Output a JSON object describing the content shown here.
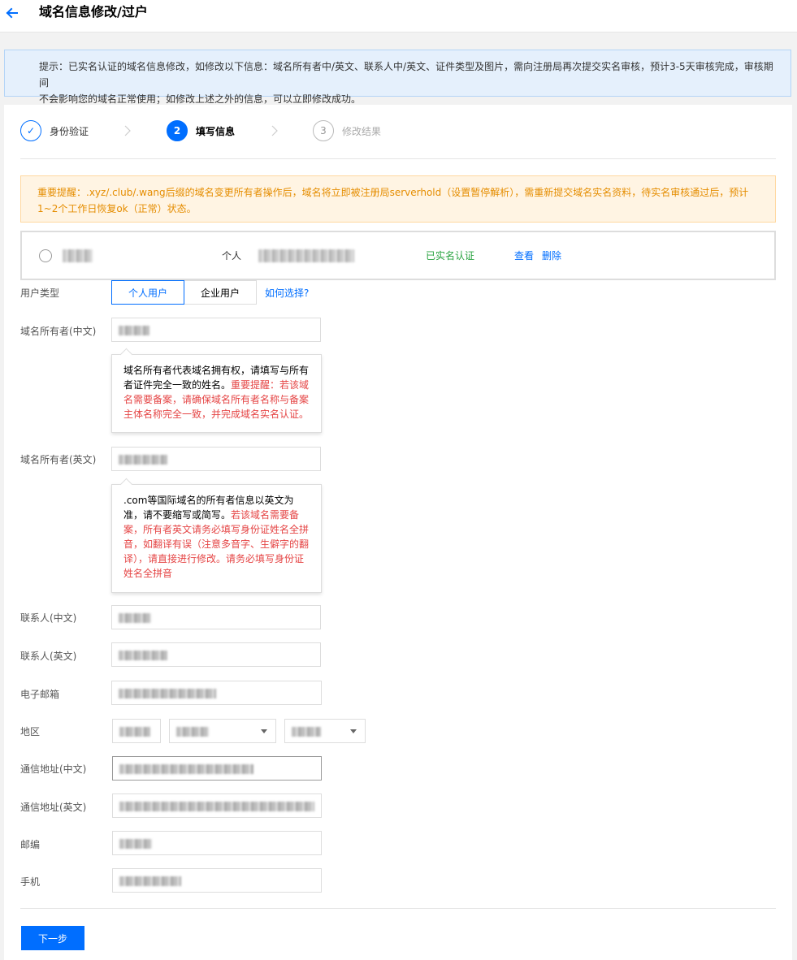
{
  "header": {
    "title": "域名信息修改/过户",
    "back_icon": "arrow-left-icon"
  },
  "notice": {
    "lines": [
      "提示：已实名认证的域名信息修改，如修改以下信息：域名所有者中/英文、联系人中/英文、证件类型及图片，需向注册局再次提交实名审核，预计3-5天审核完成，审核期间",
      "不会影响您的域名正常使用；如修改上述之外的信息，可以立即修改成功。"
    ]
  },
  "stepper": {
    "steps": [
      {
        "mark": "✓",
        "label": "身份验证",
        "state": "done"
      },
      {
        "mark": "2",
        "label": "填写信息",
        "state": "active"
      },
      {
        "mark": "3",
        "label": "修改结果",
        "state": "pending"
      }
    ]
  },
  "warning": {
    "lines": [
      "重要提醒：.xyz/.club/.wang后缀的域名变更所有者操作后，域名将立即被注册局serverhold（设置暂停解析），需重新提交域名实名资料，待实名审核通过后，预计",
      "1~2个工作日恢复ok（正常）状态。"
    ]
  },
  "contact_card": {
    "type": "个人",
    "status": "已实名认证",
    "view_label": "查看",
    "delete_label": "删除"
  },
  "form": {
    "user_type_label": "用户类型",
    "user_type_options": [
      "个人用户",
      "企业用户"
    ],
    "user_type_selected": "个人用户",
    "help_link": "如何选择?",
    "owner_cn_label": "域名所有者(中文)",
    "owner_cn_tip": {
      "plain": "域名所有者代表域名拥有权，请填写与所有者证件完全一致的姓名。",
      "warning": "重要提醒：若该域名需要备案，请确保域名所有者名称与备案主体名称完全一致，并完成域名实名认证。"
    },
    "owner_en_label": "域名所有者(英文)",
    "owner_en_tip": {
      "plain": ".com等国际域名的所有者信息以英文为准，请不要缩写或简写。",
      "warning": "若该域名需要备案，所有者英文请务必填写身份证姓名全拼音，如翻译有误（注意多音字、生僻字的翻译），请直接进行修改。请务必填写身份证姓名全拼音"
    },
    "contact_cn_label": "联系人(中文)",
    "contact_en_label": "联系人(英文)",
    "email_label": "电子邮箱",
    "region_label": "地区",
    "address_cn_label": "通信地址(中文)",
    "address_en_label": "通信地址(英文)",
    "postcode_label": "邮编",
    "phone_label": "手机"
  },
  "next_button": "下一步",
  "colors": {
    "accent": "#006eff",
    "success": "#29a340",
    "warning_text": "#e58d00",
    "warning_bg": "#fff4e3",
    "notice_bg": "#e5f0fc",
    "danger": "#e54545"
  }
}
